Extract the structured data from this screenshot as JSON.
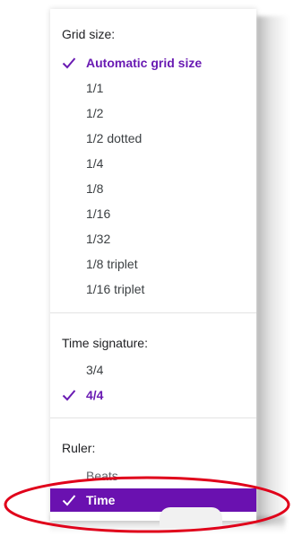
{
  "grid_size": {
    "title": "Grid size:",
    "items": [
      {
        "label": "Automatic grid size",
        "selected": true
      },
      {
        "label": "1/1",
        "selected": false
      },
      {
        "label": "1/2",
        "selected": false
      },
      {
        "label": "1/2 dotted",
        "selected": false
      },
      {
        "label": "1/4",
        "selected": false
      },
      {
        "label": "1/8",
        "selected": false
      },
      {
        "label": "1/16",
        "selected": false
      },
      {
        "label": "1/32",
        "selected": false
      },
      {
        "label": "1/8 triplet",
        "selected": false
      },
      {
        "label": "1/16 triplet",
        "selected": false
      }
    ]
  },
  "time_signature": {
    "title": "Time signature:",
    "items": [
      {
        "label": "3/4",
        "selected": false
      },
      {
        "label": "4/4",
        "selected": true
      }
    ]
  },
  "ruler": {
    "title": "Ruler:",
    "items": [
      {
        "label": "Beats",
        "selected": false
      },
      {
        "label": "Time",
        "selected": true,
        "highlighted": true
      }
    ]
  },
  "colors": {
    "accent": "#6a1bb3",
    "highlight_bg": "#6a11b0",
    "annotation": "#e0001a"
  },
  "icons": {
    "check": "check-icon"
  }
}
